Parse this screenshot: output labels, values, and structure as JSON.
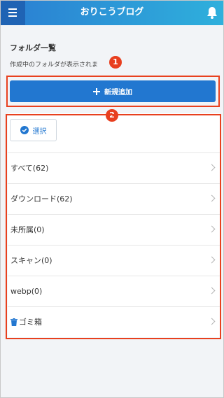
{
  "header": {
    "title": "おりこうブログ",
    "menu_icon": "hamburger-menu-icon",
    "bell_icon": "bell-icon",
    "colors": {
      "gradient_start": "#2a7ed2",
      "gradient_end": "#2fb0dc",
      "menu_bg": "#1f63b4"
    }
  },
  "page": {
    "title": "フォルダ一覧",
    "description": "作成中のフォルダが表示されま"
  },
  "markers": {
    "one": "1",
    "two": "2",
    "color": "#e83e1e"
  },
  "actions": {
    "add_label": "新規追加",
    "add_icon": "plus-icon",
    "select_label": "選択",
    "select_icon": "check-circle-icon"
  },
  "folders": [
    {
      "label": "すべて(62)"
    },
    {
      "label": "ダウンロード(62)"
    },
    {
      "label": "未所属(0)"
    },
    {
      "label": "スキャン(0)"
    },
    {
      "label": "webp(0)"
    },
    {
      "label": "ゴミ箱",
      "icon": "trash-icon"
    }
  ],
  "colors": {
    "accent": "#2277d0",
    "highlight_border": "#e8401e",
    "background": "#f2f4f7"
  }
}
